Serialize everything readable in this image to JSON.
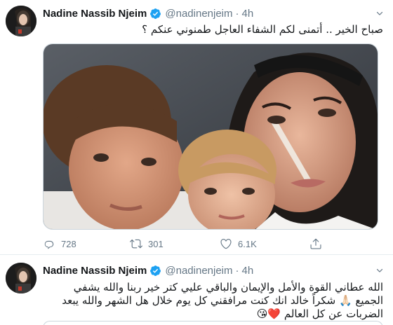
{
  "tweets": [
    {
      "display_name": "Nadine Nassib Njeim",
      "handle": "@nadinenjeim",
      "separator": "·",
      "time": "4h",
      "text": "صباح الخير .. أتمنى لكم الشفاء العاجل طمنوني عنكم ؟",
      "has_media": true,
      "stats": {
        "replies": "728",
        "retweets": "301",
        "likes": "6.1K"
      }
    },
    {
      "display_name": "Nadine Nassib Njeim",
      "handle": "@nadinenjeim",
      "separator": "·",
      "time": "4h",
      "text": "الله عطاني القوة والأمل والإيمان والباقي عليي كتر خير ربنا والله يشفي الجميع 🙏🏻 شكراً خالد انك كنت مرافقني كل يوم خلال هل الشهر والله يبعد الضربات عن كل العالم ❤️😘"
    }
  ],
  "icons": {
    "verified": "verified-badge-icon",
    "caret": "chevron-down-icon",
    "reply": "reply-icon",
    "retweet": "retweet-icon",
    "like": "heart-icon",
    "share": "share-icon"
  },
  "colors": {
    "verified_blue": "#1da1f2",
    "secondary_text": "#657786",
    "primary_text": "#14171a",
    "border": "#e6ecf0"
  }
}
